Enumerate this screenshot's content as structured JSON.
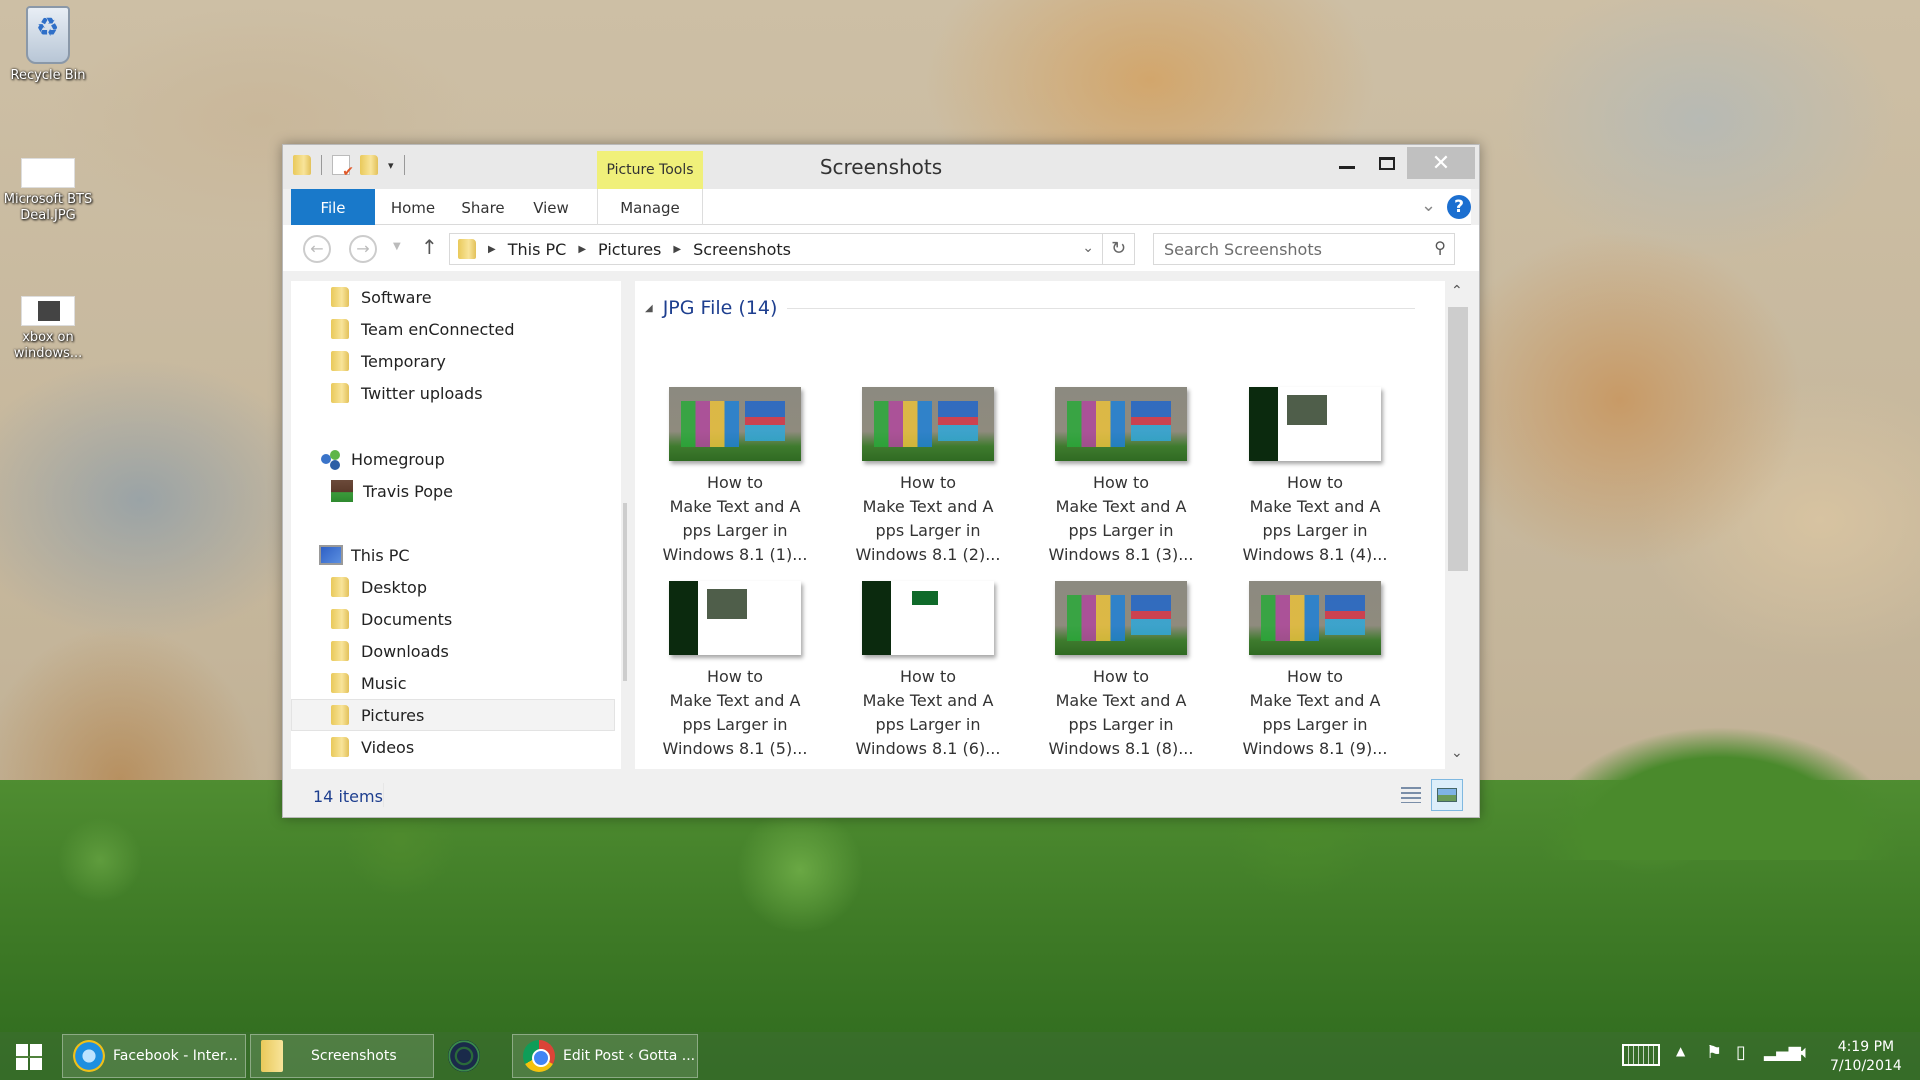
{
  "desktop": {
    "icons": [
      {
        "label": "Recycle Bin",
        "icon": "recycle-bin-icon"
      },
      {
        "label": "Microsoft BTS Deal.JPG",
        "icon": "image-file-icon"
      },
      {
        "label": "xbox on windows...",
        "icon": "image-file-icon"
      }
    ]
  },
  "window": {
    "title": "Screenshots",
    "contextual_tab_group": "Picture Tools",
    "ribbon_tabs": [
      "File",
      "Home",
      "Share",
      "View",
      "Manage"
    ],
    "address": {
      "breadcrumbs": [
        "This PC",
        "Pictures",
        "Screenshots"
      ]
    },
    "search": {
      "placeholder": "Search Screenshots",
      "value": ""
    },
    "nav_pane": {
      "items": [
        {
          "label": "Software",
          "icon": "folder-icon"
        },
        {
          "label": "Team enConnected",
          "icon": "folder-icon"
        },
        {
          "label": "Temporary",
          "icon": "folder-icon"
        },
        {
          "label": "Twitter uploads",
          "icon": "folder-icon"
        },
        {
          "label": "Homegroup",
          "icon": "homegroup-icon"
        },
        {
          "label": "Travis Pope",
          "icon": "user-avatar"
        },
        {
          "label": "This PC",
          "icon": "computer-icon"
        },
        {
          "label": "Desktop",
          "icon": "desktop-folder-icon"
        },
        {
          "label": "Documents",
          "icon": "documents-folder-icon"
        },
        {
          "label": "Downloads",
          "icon": "downloads-folder-icon"
        },
        {
          "label": "Music",
          "icon": "music-folder-icon"
        },
        {
          "label": "Pictures",
          "icon": "pictures-folder-icon",
          "selected": true
        },
        {
          "label": "Videos",
          "icon": "videos-folder-icon"
        }
      ]
    },
    "content": {
      "group_title": "JPG File (14)",
      "files": [
        {
          "line1": "How to",
          "line2": "Make Text and A",
          "line3": "pps Larger in",
          "line4": "Windows 8.1 (1)...",
          "thumb": "start-screen"
        },
        {
          "line1": "How to",
          "line2": "Make Text and A",
          "line3": "pps Larger in",
          "line4": "Windows 8.1 (2)...",
          "thumb": "start-screen"
        },
        {
          "line1": "How to",
          "line2": "Make Text and A",
          "line3": "pps Larger in",
          "line4": "Windows 8.1 (3)...",
          "thumb": "start-screen"
        },
        {
          "line1": "How to",
          "line2": "Make Text and A",
          "line3": "pps Larger in",
          "line4": "Windows 8.1 (4)...",
          "thumb": "settings"
        },
        {
          "line1": "How to",
          "line2": "Make Text and A",
          "line3": "pps Larger in",
          "line4": "Windows 8.1 (5)...",
          "thumb": "settings"
        },
        {
          "line1": "How to",
          "line2": "Make Text and A",
          "line3": "pps Larger in",
          "line4": "Windows 8.1 (6)...",
          "thumb": "settings"
        },
        {
          "line1": "How to",
          "line2": "Make Text and A",
          "line3": "pps Larger in",
          "line4": "Windows 8.1 (8)...",
          "thumb": "start-screen"
        },
        {
          "line1": "How to",
          "line2": "Make Text and A",
          "line3": "pps Larger in",
          "line4": "Windows 8.1 (9)...",
          "thumb": "start-screen"
        }
      ]
    },
    "status": {
      "item_count": "14 items"
    }
  },
  "taskbar": {
    "items": [
      {
        "label": "Facebook - Inter...",
        "icon": "internet-explorer-icon"
      },
      {
        "label": "Screenshots",
        "icon": "file-explorer-icon"
      },
      {
        "label": "",
        "icon": "app-icon"
      },
      {
        "label": "Edit Post ‹ Gotta ...",
        "icon": "chrome-icon"
      }
    ],
    "clock": {
      "time": "4:19 PM",
      "date": "7/10/2014"
    }
  },
  "colors": {
    "accent": "#1979ca",
    "contextual_tab": "#f0f07a",
    "group_title": "#1e3f8f"
  }
}
